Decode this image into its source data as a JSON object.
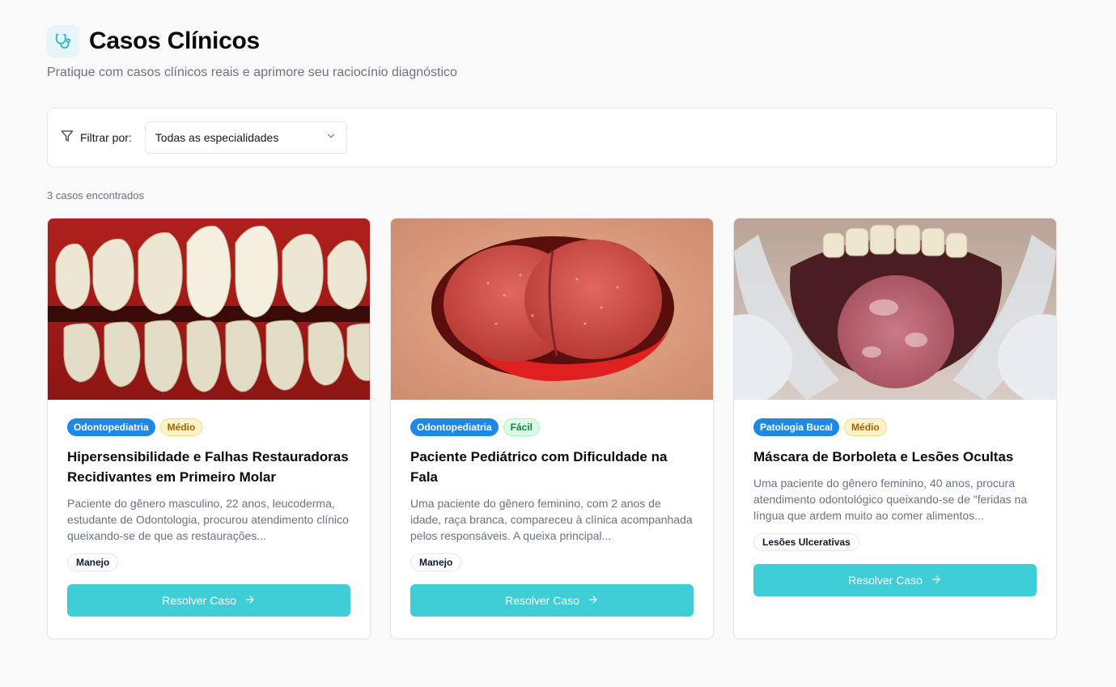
{
  "header": {
    "title": "Casos Clínicos",
    "subtitle": "Pratique com casos clínicos reais e aprimore seu raciocínio diagnóstico"
  },
  "filter": {
    "label": "Filtrar por:",
    "selected": "Todas as especialidades"
  },
  "results": {
    "count_text": "3 casos encontrados"
  },
  "cards": [
    {
      "specialty": "Odontopediatria",
      "difficulty": "Médio",
      "title": "Hipersensibilidade e Falhas Restauradoras Recidivantes em Primeiro Molar",
      "description": "Paciente do gênero masculino, 22 anos, leucoderma, estudante de Odontologia, procurou atendimento clínico queixando-se de que as restaurações...",
      "tag": "Manejo",
      "button": "Resolver Caso"
    },
    {
      "specialty": "Odontopediatria",
      "difficulty": "Fácil",
      "title": "Paciente Pediátrico com Dificuldade na Fala",
      "description": "Uma paciente do gênero feminino, com 2 anos de idade, raça branca, compareceu à clínica acompanhada pelos responsáveis. A queixa principal...",
      "tag": "Manejo",
      "button": "Resolver Caso"
    },
    {
      "specialty": "Patologia Bucal",
      "difficulty": "Médio",
      "title": "Máscara de Borboleta e Lesões Ocultas",
      "description": "Uma paciente do gênero feminino, 40 anos, procura atendimento odontológico queixando-se de \"feridas na língua que ardem muito ao comer alimentos...",
      "tag": "Lesões Ulcerativas",
      "button": "Resolver Caso"
    }
  ],
  "colors": {
    "accent": "#3fcdd8",
    "specialty_badge": "#1e88e5",
    "medio_badge_bg": "#fef3c7",
    "facil_badge_bg": "#dcfce7"
  },
  "icons": {
    "header": "stethoscope-icon",
    "filter": "filter-icon",
    "select": "chevron-down-icon",
    "button": "arrow-right-icon"
  }
}
